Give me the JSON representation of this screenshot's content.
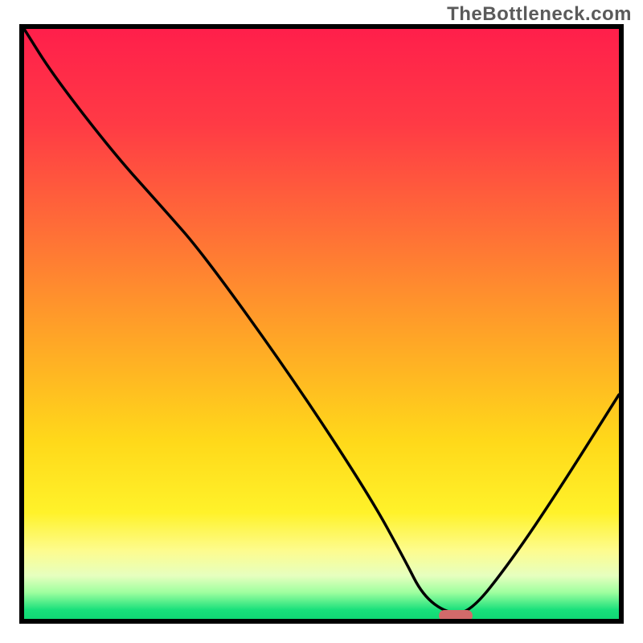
{
  "watermark_text": "TheBottleneck.com",
  "plot": {
    "inner_width": 740,
    "inner_height": 734
  },
  "gradient_stops": [
    {
      "offset": 0.0,
      "color": "#ff1f4b"
    },
    {
      "offset": 0.16,
      "color": "#ff3a45"
    },
    {
      "offset": 0.34,
      "color": "#ff6e37"
    },
    {
      "offset": 0.52,
      "color": "#ffa427"
    },
    {
      "offset": 0.7,
      "color": "#ffd91a"
    },
    {
      "offset": 0.82,
      "color": "#fff22a"
    },
    {
      "offset": 0.885,
      "color": "#fdfc8f"
    },
    {
      "offset": 0.927,
      "color": "#e6ffbf"
    },
    {
      "offset": 0.955,
      "color": "#9fff9f"
    },
    {
      "offset": 0.985,
      "color": "#18e07b"
    },
    {
      "offset": 1.0,
      "color": "#10d874"
    }
  ],
  "chart_data": {
    "type": "line",
    "title": "",
    "xlabel": "",
    "ylabel": "",
    "xlim": [
      0,
      100
    ],
    "ylim": [
      0,
      100
    ],
    "series": [
      {
        "name": "bottleneck-curve",
        "x": [
          0,
          5,
          15,
          23,
          30,
          45,
          58,
          64,
          67,
          71,
          75,
          82,
          90,
          100
        ],
        "y": [
          100,
          92,
          79,
          70,
          62,
          41,
          21,
          10,
          4,
          1,
          1,
          10,
          22,
          38
        ]
      }
    ],
    "marker": {
      "name": "optimal-range",
      "x_center": 72.5,
      "y": 0.6,
      "color": "#d26a6a"
    }
  }
}
